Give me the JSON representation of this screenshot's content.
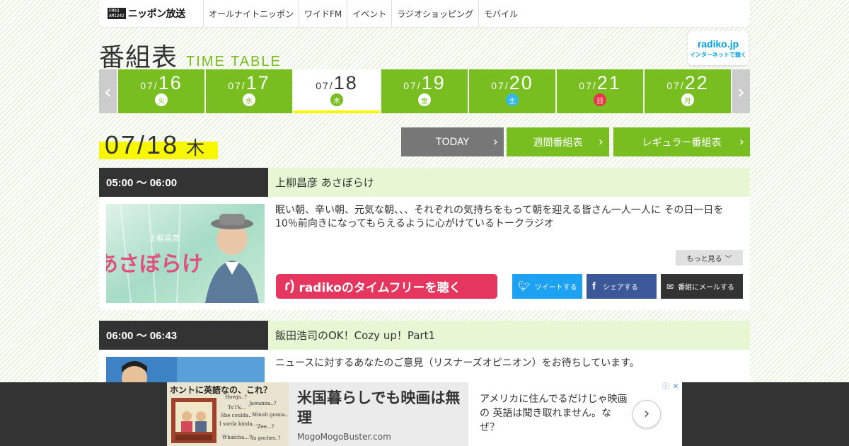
{
  "header": {
    "logo_mini": [
      "FM93",
      "AM1242"
    ],
    "logo_text": "ニッポン放送",
    "nav": [
      "オールナイトニッポン",
      "ワイドFM",
      "イベント",
      "ラジオショッピング",
      "モバイル"
    ]
  },
  "page_title": {
    "jp": "番組表",
    "en": "TIME TABLE"
  },
  "radiko_badge": {
    "brand": "radiko.jp",
    "sub": "インターネットで聴く"
  },
  "dates": [
    {
      "month": "07/",
      "day": "16",
      "weekday": "火",
      "kind": "normal"
    },
    {
      "month": "07/",
      "day": "17",
      "weekday": "水",
      "kind": "normal"
    },
    {
      "month": "07/",
      "day": "18",
      "weekday": "木",
      "kind": "selected"
    },
    {
      "month": "07/",
      "day": "19",
      "weekday": "金",
      "kind": "normal"
    },
    {
      "month": "07/",
      "day": "20",
      "weekday": "土",
      "kind": "sat"
    },
    {
      "month": "07/",
      "day": "21",
      "weekday": "日",
      "kind": "sun"
    },
    {
      "month": "07/",
      "day": "22",
      "weekday": "月",
      "kind": "normal"
    }
  ],
  "current": {
    "date": "07/18",
    "weekday": "木"
  },
  "buttons": {
    "today": "TODAY",
    "weekly": "週間番組表",
    "regular": "レギュラー番組表"
  },
  "programs": [
    {
      "time": "05:00 ～ 06:00",
      "title": "上柳昌彦 あさぼらけ",
      "desc": "眠い朝、辛い朝、元気な朝、、、それぞれの気持ちをもって朝を迎える皆さん一人一人に その日一日を10％前向きになってもらえるように心がけているトークラジオ",
      "image_title": "あさぼらけ",
      "image_sub": "上柳昌彦",
      "more": "もっと見る",
      "radiko": "radikoのタイムフリーを聴く",
      "tweet": "ツイートする",
      "share": "シェアする",
      "mail": "番組にメールする"
    },
    {
      "time": "06:00 ～ 06:43",
      "title": "飯田浩司のOK！Cozy up！Part1",
      "desc": "ニュースに対するあなたのご意見（リスナーズオピニオン）をお待ちしています。"
    }
  ],
  "ad": {
    "image_caption": "ホントに英語なの、これ？",
    "image_bubbles": [
      "Howja..?",
      "Jawanna..?",
      "Ts'I'k...",
      "She coulda..",
      "Whatcha...?",
      "Ya gocher..?",
      "I sorda kinda..",
      "Mmuh gonna..",
      "'Zee...?"
    ],
    "headline": "米国暮らしでも映画は無理",
    "domain": "MogoMogoBuster.com",
    "text": "アメリカに住んでるだけじゃ映画の 英語は聞き取れません。なぜ？",
    "colors": {
      "info": "#4a90e2"
    }
  },
  "colors": {
    "green": "#78be20",
    "dark": "#333333",
    "yellow": "#f7f700",
    "light_green": "#e7f6d3",
    "pink": "#e5365f",
    "twitter": "#1da1f2",
    "facebook": "#3b5998"
  }
}
